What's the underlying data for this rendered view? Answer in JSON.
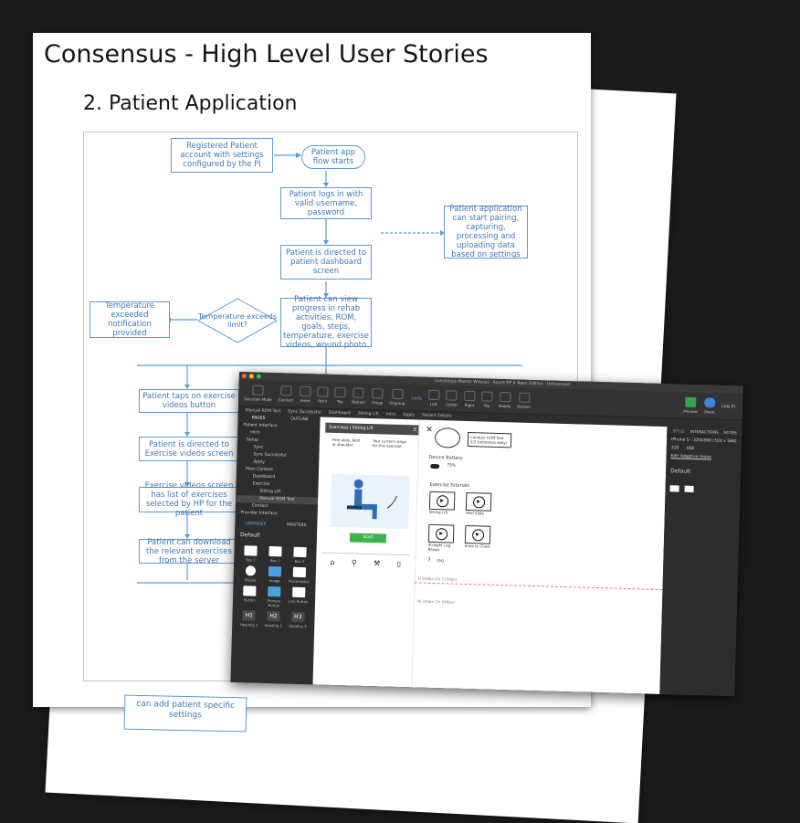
{
  "slide": {
    "title": "Consensus - High Level User Stories",
    "subtitle": "2. Patient Application"
  },
  "flowchart": {
    "registered": "Registered Patient account with settings configured by the PI",
    "flow_starts": "Patient app flow starts",
    "logs_in": "Patient logs in with valid username, password",
    "pairing": "Patient application can start pairing, capturing, processing and uploading data based on settings",
    "directed_dashboard": "Patient is directed to patient dashboard screen",
    "view_progress": "Patient can view progress in rehab activities, ROM, goals, steps, temperature, exercise videos, wound photo",
    "temp_limit": "Temperature exceeds limit?",
    "temp_notice": "Temperature exceeded notification provided",
    "taps_videos": "Patient taps on exercise videos button",
    "directed_videos": "Patient is directed to Exercise videos screen",
    "list_exercises": "Exercise videos screen has list of exercises selected by HP for the patient",
    "download": "Patient can download the relevant exercises from the server",
    "settings_fragment": "can add patient specific settings"
  },
  "colors": {
    "background": "#1b1b1b",
    "flow_blue": "#5b9bd5",
    "flow_text": "#3f79b6",
    "app_dark": "#2b2b2b",
    "start_green": "#3bb54a"
  },
  "app": {
    "window_title": "Consensus Master Wireset - Axure RP 9 Team Edition : Unlicensed",
    "toolbar": [
      "Selection Mode",
      "Connect",
      "Insert",
      "Point",
      "Top",
      "Bottom",
      "Group",
      "Ungroup",
      "Left",
      "Center",
      "Right",
      "Top",
      "Middle",
      "Bottom",
      "Preview",
      "Share"
    ],
    "zoom": "100%",
    "login": "Log In",
    "left_tabs": [
      "PAGES",
      "OUTLINE"
    ],
    "pages": [
      "Patient Interface",
      "Intro",
      "Setup",
      "Sync",
      "Sync Successful",
      "Apply",
      "Main Content",
      "Dashboard",
      "Exercise",
      "Sitting Lift",
      "Manual ROM Test",
      "Contact",
      "Provider Interface"
    ],
    "lib_tabs": [
      "LIBRARIES",
      "MASTERS"
    ],
    "library_name": "Default",
    "lib_items": [
      "Box 1",
      "Box 2",
      "Box 3",
      "Ellipse",
      "Image",
      "Placeholder",
      "Button",
      "Primary Button",
      "Link Button",
      "Heading 1",
      "Heading 2",
      "Heading 3"
    ],
    "heading_glyphs": [
      "H1",
      "H2",
      "H3"
    ],
    "right_tabs": [
      "STYLE",
      "INTERACTIONS",
      "NOTES"
    ],
    "adaptive_view": "iPhone 5 - 320x568 (320 x 568)",
    "width_value": "320",
    "height_value": "568",
    "edit_adaptive": "Edit Adaptive Views",
    "style_default": "Default",
    "page_tabs": [
      "Manual ROM Test",
      "Sync Successful",
      "Dashboard",
      "Sitting Lift",
      "Intro",
      "Apply",
      "Patient Details"
    ],
    "phone_header": "Exercises | Sitting Lift",
    "exercise_note": "Feet wide, Rest at shoulder",
    "target_range": "Your current range for this exercise",
    "start_label": "Start",
    "conduct_test": "Conduct ROM Test 2/3 (refreshes daily)",
    "device_battery": "Device Battery",
    "battery_pct": "75%",
    "tutorials_title": "Exercise Tutorials",
    "tutorials": [
      "Sitting Lift",
      "Heel Slide",
      "Straight Leg Raises",
      "Knee to Chest"
    ],
    "faq": "FAQ",
    "size1": "H 568px (2x 1136px)",
    "size2": "W 320px (2x 640px)"
  }
}
